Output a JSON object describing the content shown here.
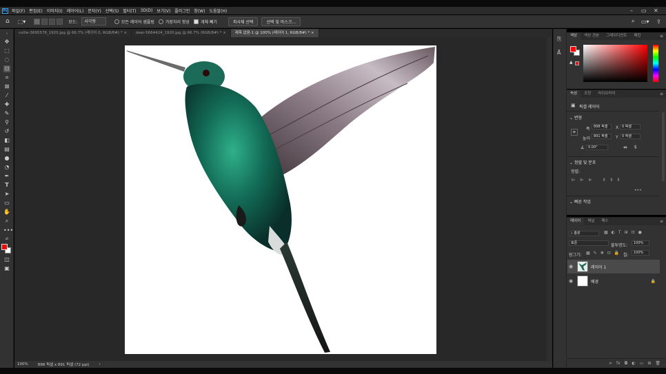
{
  "app": {
    "logo": "Ps",
    "menus": [
      "파일(F)",
      "편집(E)",
      "이미지(I)",
      "레이어(L)",
      "문자(Y)",
      "선택(S)",
      "필터(T)",
      "3D(D)",
      "보기(V)",
      "플러그인",
      "창(W)",
      "도움말(H)"
    ],
    "window_controls": [
      "–",
      "▭",
      "✕"
    ]
  },
  "options": {
    "mode_label": "모드:",
    "mode_value": "사각형",
    "sample_all_layers": "모든 레이어 샘플링",
    "hard_edge": "가장자리 향상",
    "auto_enhance": "개체 빼기",
    "select_subject": "피사체 선택",
    "select_and_mask": "선택 및 마스크..."
  },
  "tabs": [
    {
      "label": "collie-3695578_1920.jpg @ 66.7% (레이어 0, RGB/8#) *",
      "close": "×",
      "active": false
    },
    {
      "label": "deer-5664424_1920.jpg @ 66.7% (RGB/8#) *",
      "close": "×",
      "active": false
    },
    {
      "label": "제목 없음-1 @ 100% (레이어 1, RGB/8#) *",
      "close": "×",
      "active": true
    }
  ],
  "status": {
    "zoom": "100%",
    "doc_size": "898 픽셀 x 891 픽셀 (72 ppi)",
    "arrow": "›"
  },
  "color_panel": {
    "tabs": [
      "색상",
      "색상 견본",
      "그레이디언트",
      "패턴"
    ],
    "fg_color": "#ff0000",
    "bg_color": "#ffffff",
    "picked_color": "#e0141e"
  },
  "properties_panel": {
    "tabs": [
      "속성",
      "조정",
      "라이브러리"
    ],
    "layer_type": "픽셀 레이어",
    "transform_title": "변형",
    "w_label": "폭",
    "w_value": "898 픽셀",
    "x_label": "X",
    "x_value": "0 픽셀",
    "h_label": "높이",
    "h_value": "891 픽셀",
    "y_label": "Y",
    "y_value": "0 픽셀",
    "angle_value": "0.00°",
    "align_title": "정렬 및 분포",
    "align_label": "정렬:",
    "more": "•••",
    "quick_actions": "빠른 작업"
  },
  "layers_panel": {
    "tabs": [
      "레이어",
      "채널",
      "패스"
    ],
    "filter_kind": "종류",
    "blend_mode": "표준",
    "opacity_label": "불투명도:",
    "opacity_value": "100%",
    "lock_label": "잠그기:",
    "fill_label": "칠:",
    "fill_value": "100%",
    "layers": [
      {
        "name": "레이어 1",
        "selected": true,
        "locked": false
      },
      {
        "name": "배경",
        "selected": false,
        "locked": true
      }
    ]
  }
}
